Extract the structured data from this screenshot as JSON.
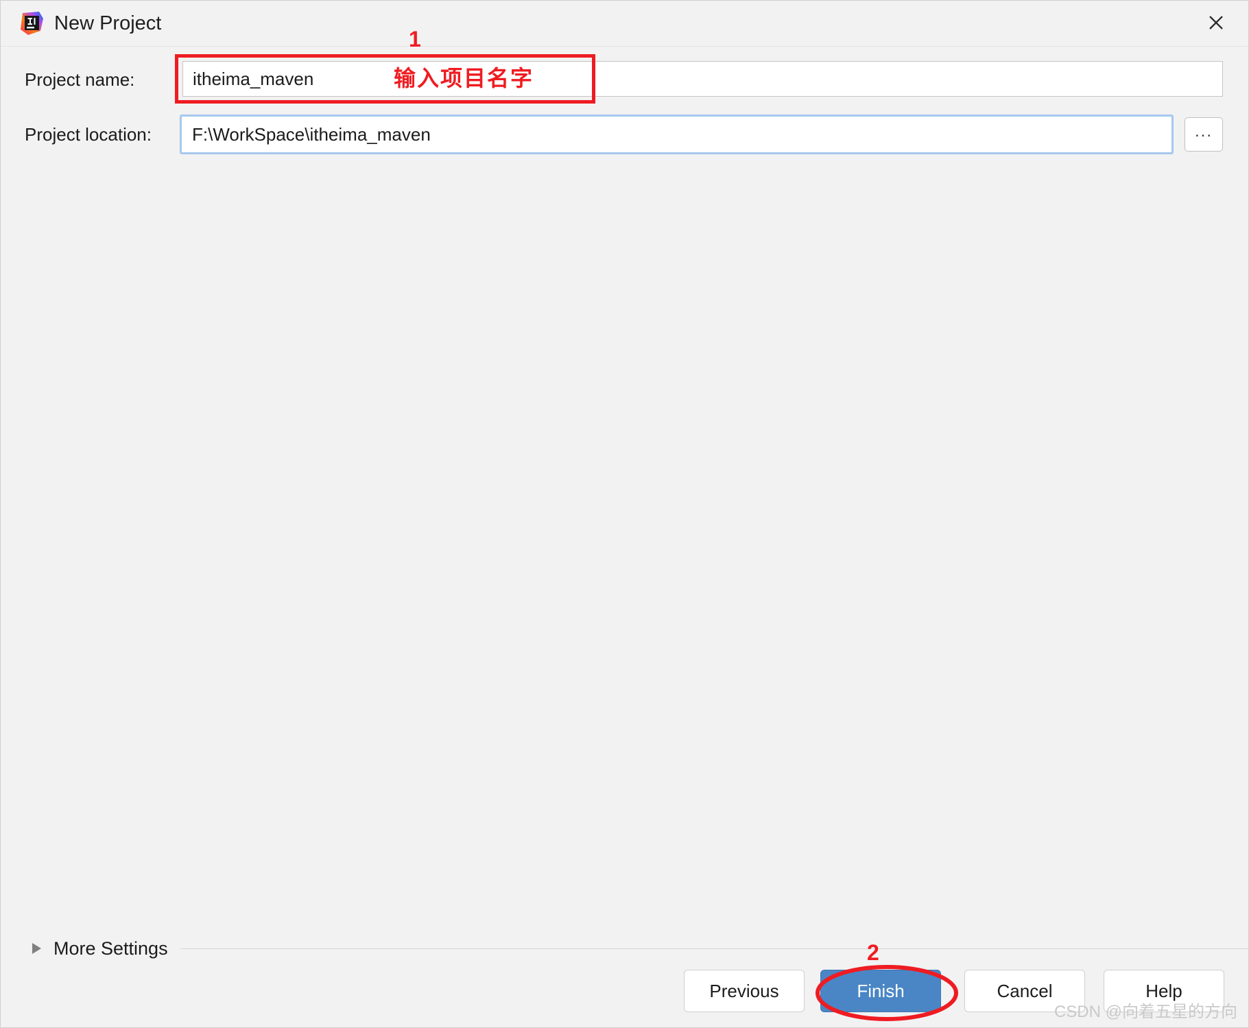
{
  "window": {
    "title": "New Project",
    "app_icon": "intellij-idea-icon",
    "close_icon": "close-icon"
  },
  "form": {
    "project_name": {
      "label": "Project name:",
      "value": "itheima_maven",
      "placeholder": ""
    },
    "project_location": {
      "label": "Project location:",
      "value": "F:\\WorkSpace\\itheima_maven",
      "placeholder": "",
      "browse_label": "..."
    }
  },
  "more_settings": {
    "label": "More Settings",
    "expanded": false,
    "arrow_icon": "chevron-right-icon"
  },
  "footer": {
    "previous_label": "Previous",
    "finish_label": "Finish",
    "cancel_label": "Cancel",
    "help_label": "Help"
  },
  "annotations": {
    "step1_number": "1",
    "step1_text": "输入项目名字",
    "step2_number": "2",
    "color": "#ee1c22"
  },
  "watermark": {
    "text": "CSDN @向着五星的方向"
  },
  "colors": {
    "dialog_bg": "#f2f2f2",
    "field_bg": "#ffffff",
    "focus_ring": "#a6c8ed",
    "primary_button": "#4a86c5",
    "annotation_red": "#ee1c22"
  }
}
